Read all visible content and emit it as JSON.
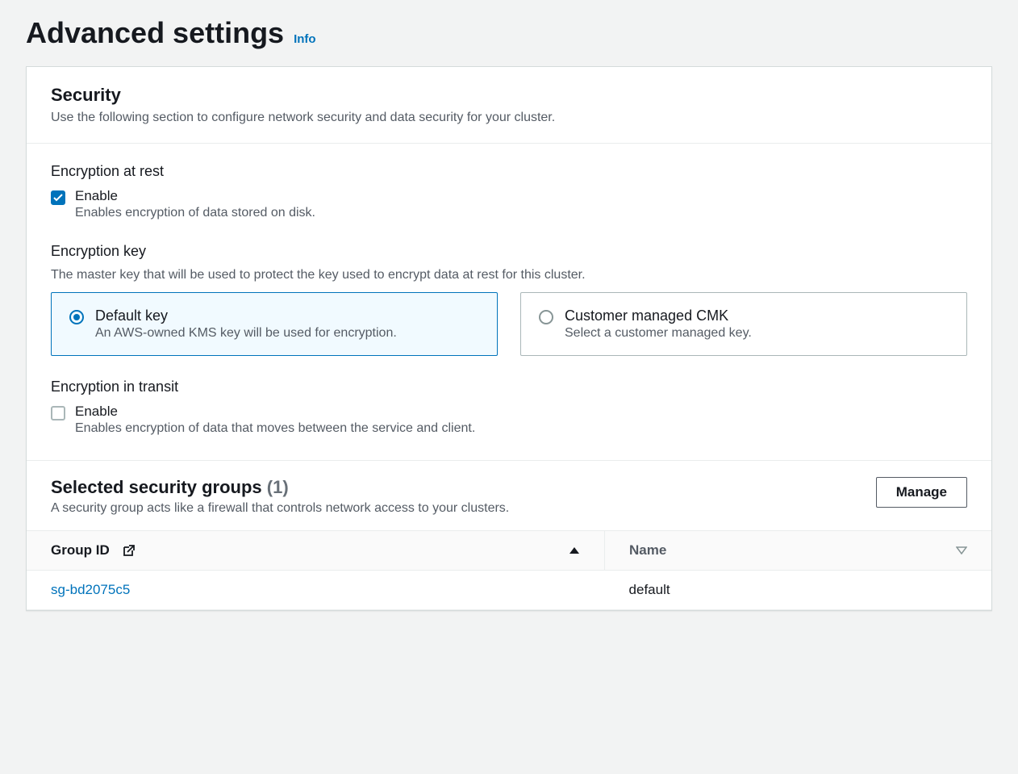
{
  "header": {
    "title": "Advanced settings",
    "info": "Info"
  },
  "security": {
    "title": "Security",
    "desc": "Use the following section to configure network security and data security for your cluster.",
    "encryption_at_rest": {
      "label": "Encryption at rest",
      "enable_label": "Enable",
      "enable_desc": "Enables encryption of data stored on disk.",
      "checked": true
    },
    "encryption_key": {
      "label": "Encryption key",
      "desc": "The master key that will be used to protect the key used to encrypt data at rest for this cluster.",
      "options": [
        {
          "title": "Default key",
          "desc": "An AWS-owned KMS key will be used for encryption.",
          "selected": true
        },
        {
          "title": "Customer managed CMK",
          "desc": "Select a customer managed key.",
          "selected": false
        }
      ]
    },
    "encryption_in_transit": {
      "label": "Encryption in transit",
      "enable_label": "Enable",
      "enable_desc": "Enables encryption of data that moves between the service and client.",
      "checked": false
    }
  },
  "security_groups": {
    "title": "Selected security groups",
    "count": "(1)",
    "desc": "A security group acts like a firewall that controls network access to your clusters.",
    "manage_button": "Manage",
    "columns": {
      "group_id": "Group ID",
      "name": "Name"
    },
    "rows": [
      {
        "group_id": "sg-bd2075c5",
        "name": "default"
      }
    ]
  }
}
